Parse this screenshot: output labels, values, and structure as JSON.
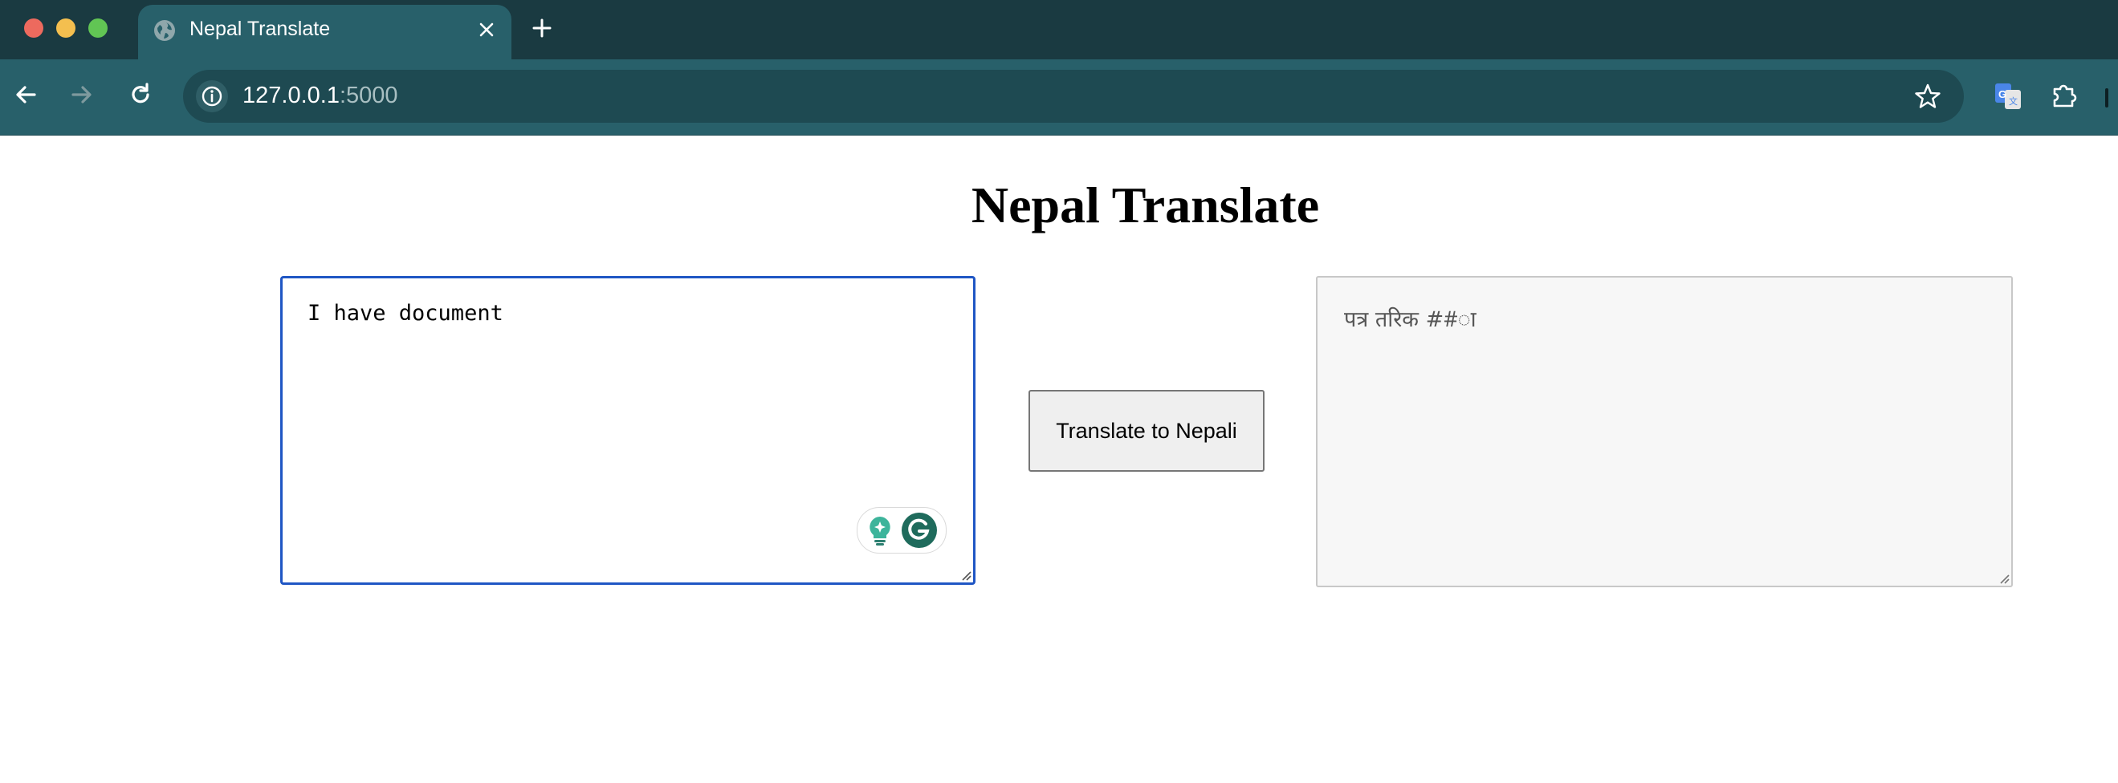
{
  "browser": {
    "tab": {
      "title": "Nepal Translate",
      "favicon_icon": "globe-icon",
      "close_icon": "close-icon"
    },
    "new_tab_icon": "plus-icon",
    "nav": {
      "back_icon": "arrow-left-icon",
      "forward_icon": "arrow-right-icon",
      "reload_icon": "reload-icon"
    },
    "address_bar": {
      "site_info_icon": "info-icon",
      "host": "127.0.0.1",
      "port": ":5000",
      "bookmark_icon": "star-icon"
    },
    "extensions": [
      "google-translate-icon",
      "puzzle-icon"
    ],
    "colors": {
      "tab_strip": "#1a3a41",
      "active_tab": "#28606a",
      "omnibox": "#1e4a52"
    }
  },
  "page": {
    "heading": "Nepal Translate",
    "input": {
      "value": "I have document",
      "focused": true,
      "focus_color": "#1f56c4"
    },
    "grammarly": {
      "icons": [
        "bulb-sparkle-icon",
        "grammarly-g-icon"
      ],
      "color": "#15c39a"
    },
    "translate_button": {
      "label": "Translate to Nepali"
    },
    "output": {
      "value": "पत्र तरिक ##ा",
      "readonly": true
    }
  }
}
